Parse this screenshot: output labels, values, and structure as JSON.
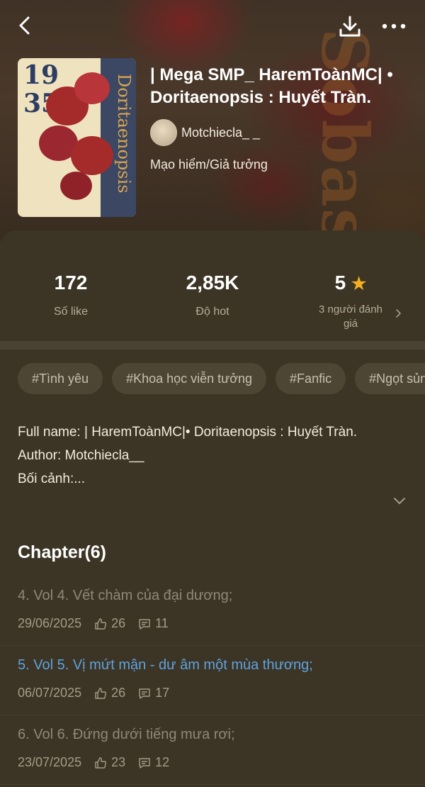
{
  "header": {
    "back_icon": "chevron-left-icon",
    "download_icon": "download-icon",
    "more_icon": "more-horizontal-icon"
  },
  "book": {
    "title": "| Mega SMP_ HaremToànMC| • Doritaenopsis : Huyết Tràn.",
    "author": "Motchiecla_ _",
    "genre": "Mạo hiểm/Giả tưởng",
    "cover": {
      "year_top": "19",
      "year_bottom": "35",
      "spine_title": "Doritaenopsis"
    }
  },
  "stats": {
    "likes": {
      "value": "172",
      "label": "Số like"
    },
    "hot": {
      "value": "2,85K",
      "label": "Độ hot"
    },
    "rating": {
      "value": "5",
      "label": "3 người đánh giá"
    }
  },
  "tags": [
    "#Tình yêu",
    "#Khoa học viễn tưởng",
    "#Fanfic",
    "#Ngọt sủng"
  ],
  "description": {
    "line1": "Full name: | HaremToànMC|• Doritaenopsis : Huyết Tràn.",
    "line2": "Author: Motchiecla__",
    "line3": "Bối cảnh:..."
  },
  "chapters_heading": "Chapter(6)",
  "chapters": [
    {
      "title": "4. Vol 4. Vết chàm của đại dương;",
      "date": "29/06/2025",
      "likes": "26",
      "comments": "11"
    },
    {
      "title": "5. Vol 5. Vị mứt mận - dư âm một mùa thương;",
      "date": "06/07/2025",
      "likes": "26",
      "comments": "17"
    },
    {
      "title": "6. Vol 6. Đứng dưới tiếng mưa rơi;",
      "date": "23/07/2025",
      "likes": "23",
      "comments": "12"
    }
  ],
  "colors": {
    "background": "#3c3424",
    "active_chapter": "#5ea3e0",
    "star": "#f3b020"
  }
}
